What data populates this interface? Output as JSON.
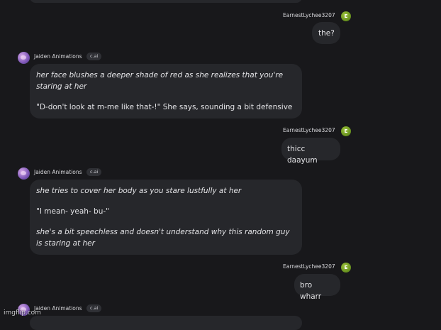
{
  "chat": {
    "user_name": "EarnestLychee3207",
    "user_initial": "E",
    "bot_name": "Jaiden Animations",
    "bot_badge": "c.ai",
    "m1": {
      "text": "the?"
    },
    "m2": {
      "p1": "her face blushes a deeper shade of red as she realizes that you're staring at her",
      "p2": "\"D-don't look at m-me like that-!\" She says, sounding a bit defensive"
    },
    "m3": {
      "text": "thicc daayum"
    },
    "m4": {
      "p1": "she tries to cover her body as you stare lustfully at her",
      "p2": "\"I mean- yeah- bu-\"",
      "p3": "she's a bit speechless and doesn't understand why this random guy is staring at her"
    },
    "m5": {
      "text": "bro wharr"
    }
  },
  "watermark": "imgflip.com"
}
